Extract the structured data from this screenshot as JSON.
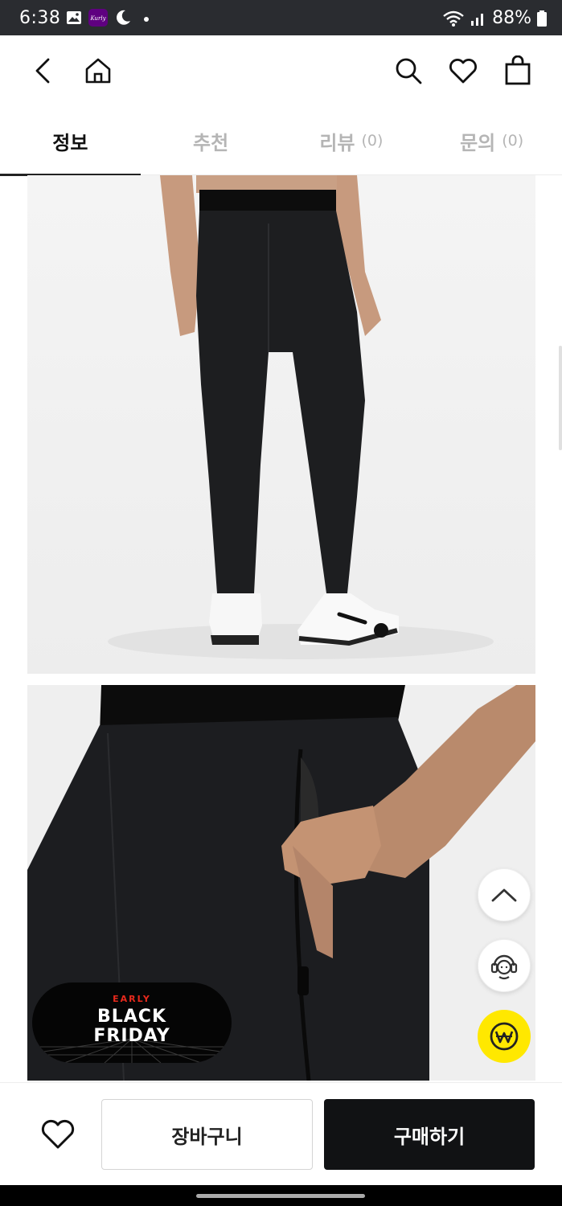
{
  "status_bar": {
    "time": "6:38",
    "battery": "88%",
    "icons": [
      "gallery-icon",
      "kurly-app-icon",
      "moon-icon",
      "dot-icon",
      "wifi-icon",
      "signal-icon",
      "battery-icon"
    ],
    "app_badge": "Kurly"
  },
  "header": {
    "icons": [
      "back-icon",
      "home-icon",
      "search-icon",
      "heart-icon",
      "shopping-bag-icon"
    ]
  },
  "tabs": [
    {
      "label": "정보",
      "count": ""
    },
    {
      "label": "추천",
      "count": ""
    },
    {
      "label": "리뷰",
      "count": "(0)"
    },
    {
      "label": "문의",
      "count": "(0)"
    }
  ],
  "badge": {
    "early": "EARLY",
    "line1": "BLACK",
    "line2": "FRIDAY"
  },
  "floating": {
    "icons": [
      "scroll-top-icon",
      "customer-service-icon",
      "won-currency-icon"
    ]
  },
  "bottom_bar": {
    "cart_label": "장바구니",
    "buy_label": "구매하기"
  },
  "colors": {
    "status_bar_bg": "#2a2c30",
    "tab_active": "#111111",
    "tab_inactive": "#b5b5b5",
    "buy_button_bg": "#111214",
    "fab_yellow": "#ffe800",
    "badge_red": "#e8291c"
  }
}
